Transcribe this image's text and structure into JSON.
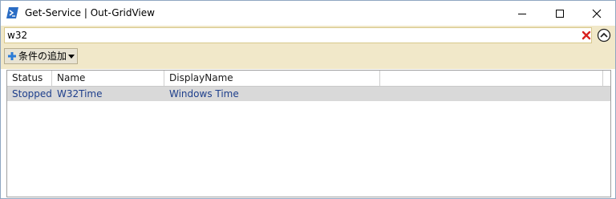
{
  "window": {
    "title": "Get-Service | Out-GridView",
    "app_icon": "powershell-icon",
    "controls": [
      "minimize-icon",
      "maximize-icon",
      "close-icon"
    ]
  },
  "filter": {
    "search_value": "w32",
    "clear_icon": "clear-x-icon",
    "collapse_icon": "collapse-up-icon",
    "add_criteria_label": "条件の追加"
  },
  "grid": {
    "columns": [
      "Status",
      "Name",
      "DisplayName",
      ""
    ],
    "rows": [
      {
        "status": "Stopped",
        "name": "W32Time",
        "display_name": "Windows Time",
        "selected": true
      }
    ]
  },
  "colors": {
    "filter_bar": "#f1e8c9",
    "selected_row": "#d9d9d9",
    "cell_text": "#1e3f8c",
    "clear_icon": "#d9221e"
  }
}
